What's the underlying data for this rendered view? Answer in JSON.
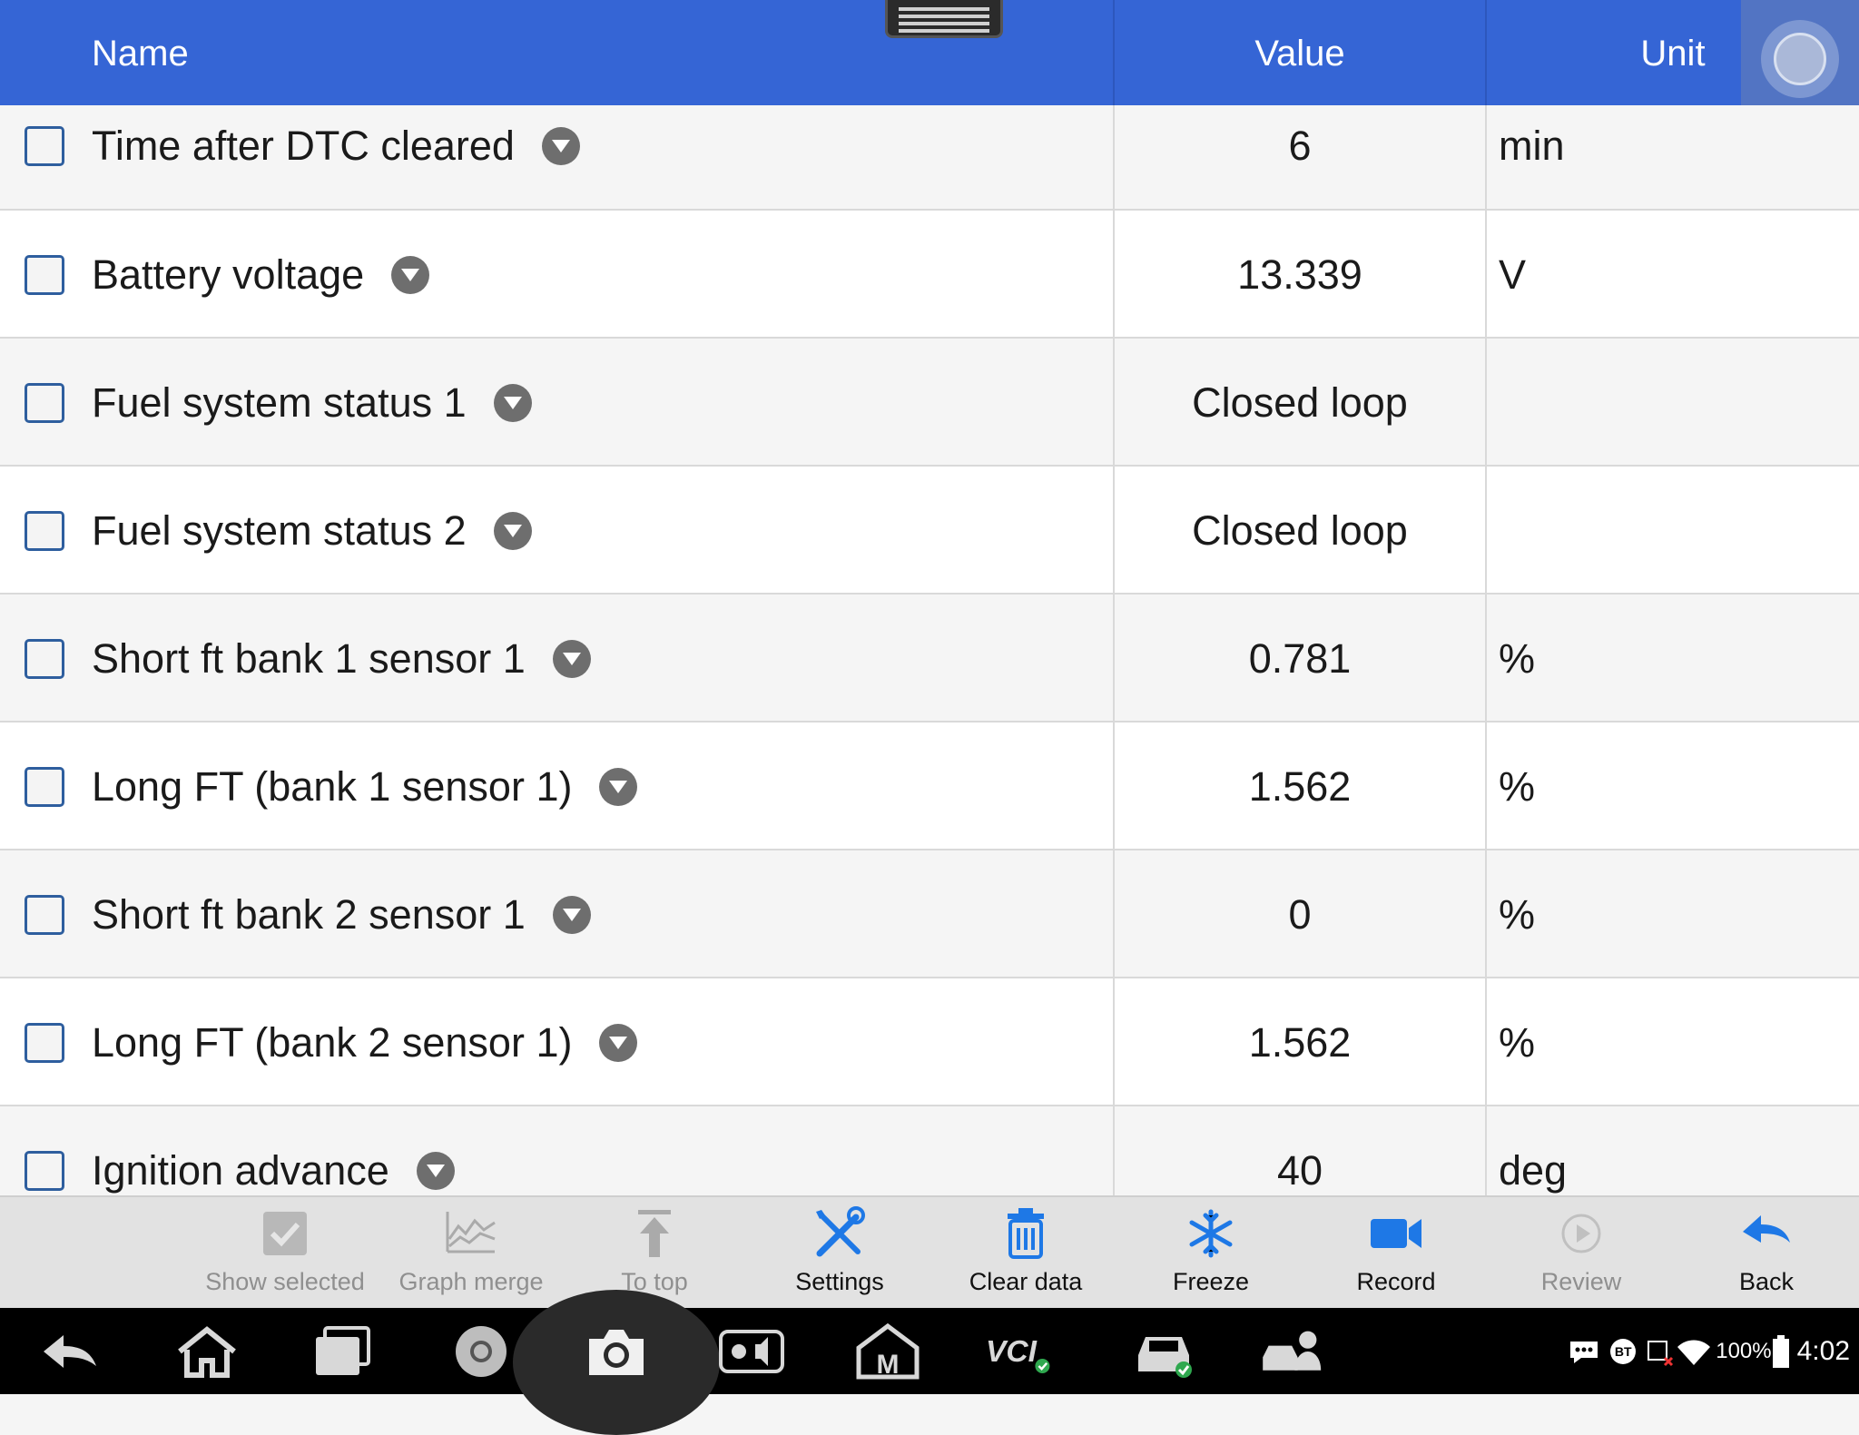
{
  "header": {
    "name_label": "Name",
    "value_label": "Value",
    "unit_label": "Unit"
  },
  "rows": [
    {
      "name": "Time after DTC cleared",
      "value": "6",
      "unit": "min",
      "checked": false
    },
    {
      "name": "Battery voltage",
      "value": "13.339",
      "unit": "V",
      "checked": false
    },
    {
      "name": "Fuel system status 1",
      "value": "Closed loop",
      "unit": "",
      "checked": false
    },
    {
      "name": "Fuel system status 2",
      "value": "Closed loop",
      "unit": "",
      "checked": false
    },
    {
      "name": "Short ft bank 1 sensor 1",
      "value": "0.781",
      "unit": "%",
      "checked": false
    },
    {
      "name": "Long FT (bank 1 sensor 1)",
      "value": "1.562",
      "unit": "%",
      "checked": false
    },
    {
      "name": "Short ft bank 2 sensor 1",
      "value": "0",
      "unit": "%",
      "checked": false
    },
    {
      "name": "Long FT (bank 2 sensor 1)",
      "value": "1.562",
      "unit": "%",
      "checked": false
    },
    {
      "name": "Ignition advance",
      "value": "40",
      "unit": "deg",
      "checked": false
    }
  ],
  "toolbar": {
    "show_selected": "Show selected",
    "graph_merge": "Graph merge",
    "to_top": "To top",
    "settings": "Settings",
    "clear_data": "Clear data",
    "freeze": "Freeze",
    "record": "Record",
    "review": "Review",
    "back": "Back"
  },
  "status_bar": {
    "bluetooth": "BT",
    "battery_percent": "100%",
    "time": "4:02"
  },
  "colors": {
    "header_blue": "#3565d5",
    "accent_blue": "#1e78e6",
    "checkbox_border": "#2e5e9e",
    "disabled_gray": "#8f8f8f"
  }
}
